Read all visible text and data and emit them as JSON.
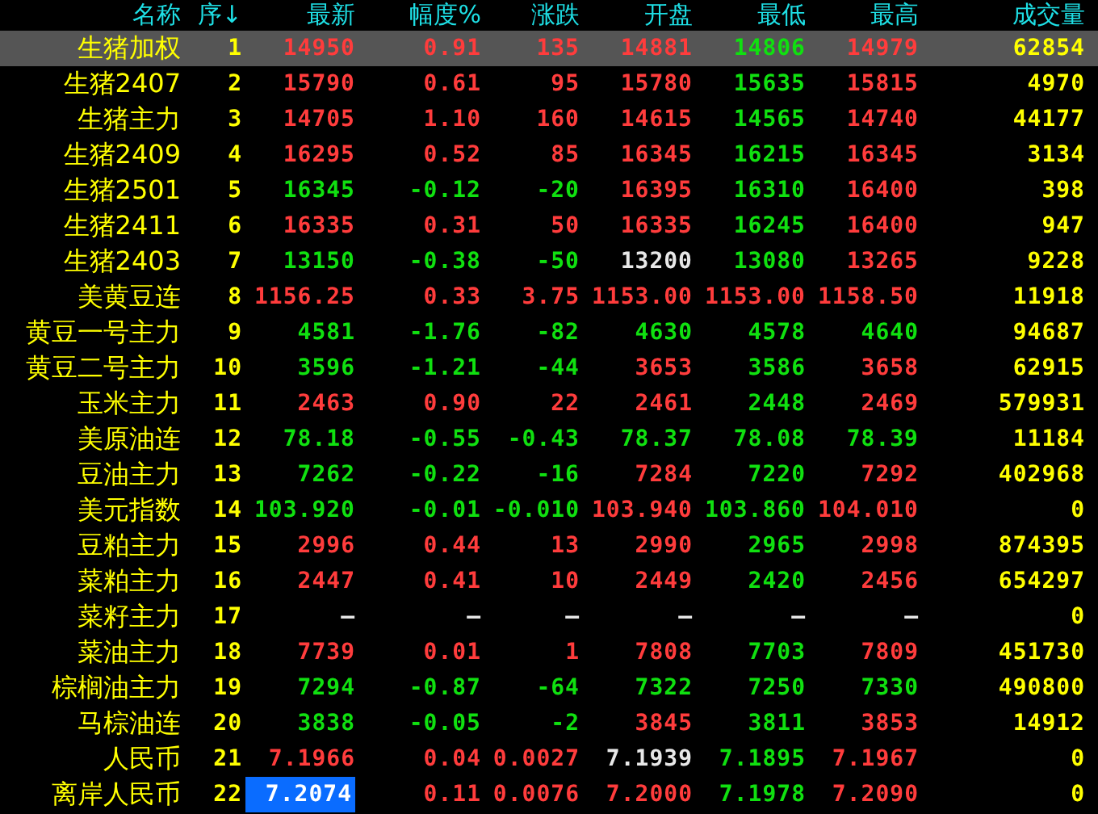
{
  "columns": [
    "名称",
    "序↓",
    "最新",
    "幅度%",
    "涨跌",
    "开盘",
    "最低",
    "最高",
    "成交量"
  ],
  "rows": [
    {
      "name": "生猪加权",
      "index": "1",
      "selected": true,
      "volume": "62854",
      "cells": [
        {
          "text": "14950",
          "color": "#ff3c3c",
          "highlighted": false
        },
        {
          "text": "0.91",
          "color": "#ff3c3c",
          "highlighted": false
        },
        {
          "text": "135",
          "color": "#ff3c3c",
          "highlighted": false
        },
        {
          "text": "14881",
          "color": "#ff3c3c",
          "highlighted": false
        },
        {
          "text": "14806",
          "color": "#10e010",
          "highlighted": false
        },
        {
          "text": "14979",
          "color": "#ff3c3c",
          "highlighted": false
        }
      ]
    },
    {
      "name": "生猪2407",
      "index": "2",
      "selected": false,
      "volume": "4970",
      "cells": [
        {
          "text": "15790",
          "color": "#ff3c3c",
          "highlighted": false
        },
        {
          "text": "0.61",
          "color": "#ff3c3c",
          "highlighted": false
        },
        {
          "text": "95",
          "color": "#ff3c3c",
          "highlighted": false
        },
        {
          "text": "15780",
          "color": "#ff3c3c",
          "highlighted": false
        },
        {
          "text": "15635",
          "color": "#10e010",
          "highlighted": false
        },
        {
          "text": "15815",
          "color": "#ff3c3c",
          "highlighted": false
        }
      ]
    },
    {
      "name": "生猪主力",
      "index": "3",
      "selected": false,
      "volume": "44177",
      "cells": [
        {
          "text": "14705",
          "color": "#ff3c3c",
          "highlighted": false
        },
        {
          "text": "1.10",
          "color": "#ff3c3c",
          "highlighted": false
        },
        {
          "text": "160",
          "color": "#ff3c3c",
          "highlighted": false
        },
        {
          "text": "14615",
          "color": "#ff3c3c",
          "highlighted": false
        },
        {
          "text": "14565",
          "color": "#10e010",
          "highlighted": false
        },
        {
          "text": "14740",
          "color": "#ff3c3c",
          "highlighted": false
        }
      ]
    },
    {
      "name": "生猪2409",
      "index": "4",
      "selected": false,
      "volume": "3134",
      "cells": [
        {
          "text": "16295",
          "color": "#ff3c3c",
          "highlighted": false
        },
        {
          "text": "0.52",
          "color": "#ff3c3c",
          "highlighted": false
        },
        {
          "text": "85",
          "color": "#ff3c3c",
          "highlighted": false
        },
        {
          "text": "16345",
          "color": "#ff3c3c",
          "highlighted": false
        },
        {
          "text": "16215",
          "color": "#10e010",
          "highlighted": false
        },
        {
          "text": "16345",
          "color": "#ff3c3c",
          "highlighted": false
        }
      ]
    },
    {
      "name": "生猪2501",
      "index": "5",
      "selected": false,
      "volume": "398",
      "cells": [
        {
          "text": "16345",
          "color": "#10e010",
          "highlighted": false
        },
        {
          "text": "-0.12",
          "color": "#10e010",
          "highlighted": false
        },
        {
          "text": "-20",
          "color": "#10e010",
          "highlighted": false
        },
        {
          "text": "16395",
          "color": "#ff3c3c",
          "highlighted": false
        },
        {
          "text": "16310",
          "color": "#10e010",
          "highlighted": false
        },
        {
          "text": "16400",
          "color": "#ff3c3c",
          "highlighted": false
        }
      ]
    },
    {
      "name": "生猪2411",
      "index": "6",
      "selected": false,
      "volume": "947",
      "cells": [
        {
          "text": "16335",
          "color": "#ff3c3c",
          "highlighted": false
        },
        {
          "text": "0.31",
          "color": "#ff3c3c",
          "highlighted": false
        },
        {
          "text": "50",
          "color": "#ff3c3c",
          "highlighted": false
        },
        {
          "text": "16335",
          "color": "#ff3c3c",
          "highlighted": false
        },
        {
          "text": "16245",
          "color": "#10e010",
          "highlighted": false
        },
        {
          "text": "16400",
          "color": "#ff3c3c",
          "highlighted": false
        }
      ]
    },
    {
      "name": "生猪2403",
      "index": "7",
      "selected": false,
      "volume": "9228",
      "cells": [
        {
          "text": "13150",
          "color": "#10e010",
          "highlighted": false
        },
        {
          "text": "-0.38",
          "color": "#10e010",
          "highlighted": false
        },
        {
          "text": "-50",
          "color": "#10e010",
          "highlighted": false
        },
        {
          "text": "13200",
          "color": "#e8e8e8",
          "highlighted": false
        },
        {
          "text": "13080",
          "color": "#10e010",
          "highlighted": false
        },
        {
          "text": "13265",
          "color": "#ff3c3c",
          "highlighted": false
        }
      ]
    },
    {
      "name": "美黄豆连",
      "index": "8",
      "selected": false,
      "volume": "11918",
      "cells": [
        {
          "text": "1156.25",
          "color": "#ff3c3c",
          "highlighted": false
        },
        {
          "text": "0.33",
          "color": "#ff3c3c",
          "highlighted": false
        },
        {
          "text": "3.75",
          "color": "#ff3c3c",
          "highlighted": false
        },
        {
          "text": "1153.00",
          "color": "#ff3c3c",
          "highlighted": false
        },
        {
          "text": "1153.00",
          "color": "#ff3c3c",
          "highlighted": false
        },
        {
          "text": "1158.50",
          "color": "#ff3c3c",
          "highlighted": false
        }
      ]
    },
    {
      "name": "黄豆一号主力",
      "index": "9",
      "selected": false,
      "volume": "94687",
      "cells": [
        {
          "text": "4581",
          "color": "#10e010",
          "highlighted": false
        },
        {
          "text": "-1.76",
          "color": "#10e010",
          "highlighted": false
        },
        {
          "text": "-82",
          "color": "#10e010",
          "highlighted": false
        },
        {
          "text": "4630",
          "color": "#10e010",
          "highlighted": false
        },
        {
          "text": "4578",
          "color": "#10e010",
          "highlighted": false
        },
        {
          "text": "4640",
          "color": "#10e010",
          "highlighted": false
        }
      ]
    },
    {
      "name": "黄豆二号主力",
      "index": "10",
      "selected": false,
      "volume": "62915",
      "cells": [
        {
          "text": "3596",
          "color": "#10e010",
          "highlighted": false
        },
        {
          "text": "-1.21",
          "color": "#10e010",
          "highlighted": false
        },
        {
          "text": "-44",
          "color": "#10e010",
          "highlighted": false
        },
        {
          "text": "3653",
          "color": "#ff3c3c",
          "highlighted": false
        },
        {
          "text": "3586",
          "color": "#10e010",
          "highlighted": false
        },
        {
          "text": "3658",
          "color": "#ff3c3c",
          "highlighted": false
        }
      ]
    },
    {
      "name": "玉米主力",
      "index": "11",
      "selected": false,
      "volume": "579931",
      "cells": [
        {
          "text": "2463",
          "color": "#ff3c3c",
          "highlighted": false
        },
        {
          "text": "0.90",
          "color": "#ff3c3c",
          "highlighted": false
        },
        {
          "text": "22",
          "color": "#ff3c3c",
          "highlighted": false
        },
        {
          "text": "2461",
          "color": "#ff3c3c",
          "highlighted": false
        },
        {
          "text": "2448",
          "color": "#10e010",
          "highlighted": false
        },
        {
          "text": "2469",
          "color": "#ff3c3c",
          "highlighted": false
        }
      ]
    },
    {
      "name": "美原油连",
      "index": "12",
      "selected": false,
      "volume": "11184",
      "cells": [
        {
          "text": "78.18",
          "color": "#10e010",
          "highlighted": false
        },
        {
          "text": "-0.55",
          "color": "#10e010",
          "highlighted": false
        },
        {
          "text": "-0.43",
          "color": "#10e010",
          "highlighted": false
        },
        {
          "text": "78.37",
          "color": "#10e010",
          "highlighted": false
        },
        {
          "text": "78.08",
          "color": "#10e010",
          "highlighted": false
        },
        {
          "text": "78.39",
          "color": "#10e010",
          "highlighted": false
        }
      ]
    },
    {
      "name": "豆油主力",
      "index": "13",
      "selected": false,
      "volume": "402968",
      "cells": [
        {
          "text": "7262",
          "color": "#10e010",
          "highlighted": false
        },
        {
          "text": "-0.22",
          "color": "#10e010",
          "highlighted": false
        },
        {
          "text": "-16",
          "color": "#10e010",
          "highlighted": false
        },
        {
          "text": "7284",
          "color": "#ff3c3c",
          "highlighted": false
        },
        {
          "text": "7220",
          "color": "#10e010",
          "highlighted": false
        },
        {
          "text": "7292",
          "color": "#ff3c3c",
          "highlighted": false
        }
      ]
    },
    {
      "name": "美元指数",
      "index": "14",
      "selected": false,
      "volume": "0",
      "cells": [
        {
          "text": "103.920",
          "color": "#10e010",
          "highlighted": false
        },
        {
          "text": "-0.01",
          "color": "#10e010",
          "highlighted": false
        },
        {
          "text": "-0.010",
          "color": "#10e010",
          "highlighted": false
        },
        {
          "text": "103.940",
          "color": "#ff3c3c",
          "highlighted": false
        },
        {
          "text": "103.860",
          "color": "#10e010",
          "highlighted": false
        },
        {
          "text": "104.010",
          "color": "#ff3c3c",
          "highlighted": false
        }
      ]
    },
    {
      "name": "豆粕主力",
      "index": "15",
      "selected": false,
      "volume": "874395",
      "cells": [
        {
          "text": "2996",
          "color": "#ff3c3c",
          "highlighted": false
        },
        {
          "text": "0.44",
          "color": "#ff3c3c",
          "highlighted": false
        },
        {
          "text": "13",
          "color": "#ff3c3c",
          "highlighted": false
        },
        {
          "text": "2990",
          "color": "#ff3c3c",
          "highlighted": false
        },
        {
          "text": "2965",
          "color": "#10e010",
          "highlighted": false
        },
        {
          "text": "2998",
          "color": "#ff3c3c",
          "highlighted": false
        }
      ]
    },
    {
      "name": "菜粕主力",
      "index": "16",
      "selected": false,
      "volume": "654297",
      "cells": [
        {
          "text": "2447",
          "color": "#ff3c3c",
          "highlighted": false
        },
        {
          "text": "0.41",
          "color": "#ff3c3c",
          "highlighted": false
        },
        {
          "text": "10",
          "color": "#ff3c3c",
          "highlighted": false
        },
        {
          "text": "2449",
          "color": "#ff3c3c",
          "highlighted": false
        },
        {
          "text": "2420",
          "color": "#10e010",
          "highlighted": false
        },
        {
          "text": "2456",
          "color": "#ff3c3c",
          "highlighted": false
        }
      ]
    },
    {
      "name": "菜籽主力",
      "index": "17",
      "selected": false,
      "volume": "0",
      "cells": [
        {
          "text": "—",
          "color": "#e8e8e8",
          "highlighted": false
        },
        {
          "text": "—",
          "color": "#e8e8e8",
          "highlighted": false
        },
        {
          "text": "—",
          "color": "#e8e8e8",
          "highlighted": false
        },
        {
          "text": "—",
          "color": "#e8e8e8",
          "highlighted": false
        },
        {
          "text": "—",
          "color": "#e8e8e8",
          "highlighted": false
        },
        {
          "text": "—",
          "color": "#e8e8e8",
          "highlighted": false
        }
      ]
    },
    {
      "name": "菜油主力",
      "index": "18",
      "selected": false,
      "volume": "451730",
      "cells": [
        {
          "text": "7739",
          "color": "#ff3c3c",
          "highlighted": false
        },
        {
          "text": "0.01",
          "color": "#ff3c3c",
          "highlighted": false
        },
        {
          "text": "1",
          "color": "#ff3c3c",
          "highlighted": false
        },
        {
          "text": "7808",
          "color": "#ff3c3c",
          "highlighted": false
        },
        {
          "text": "7703",
          "color": "#10e010",
          "highlighted": false
        },
        {
          "text": "7809",
          "color": "#ff3c3c",
          "highlighted": false
        }
      ]
    },
    {
      "name": "棕榈油主力",
      "index": "19",
      "selected": false,
      "volume": "490800",
      "cells": [
        {
          "text": "7294",
          "color": "#10e010",
          "highlighted": false
        },
        {
          "text": "-0.87",
          "color": "#10e010",
          "highlighted": false
        },
        {
          "text": "-64",
          "color": "#10e010",
          "highlighted": false
        },
        {
          "text": "7322",
          "color": "#10e010",
          "highlighted": false
        },
        {
          "text": "7250",
          "color": "#10e010",
          "highlighted": false
        },
        {
          "text": "7330",
          "color": "#10e010",
          "highlighted": false
        }
      ]
    },
    {
      "name": "马棕油连",
      "index": "20",
      "selected": false,
      "volume": "14912",
      "cells": [
        {
          "text": "3838",
          "color": "#10e010",
          "highlighted": false
        },
        {
          "text": "-0.05",
          "color": "#10e010",
          "highlighted": false
        },
        {
          "text": "-2",
          "color": "#10e010",
          "highlighted": false
        },
        {
          "text": "3845",
          "color": "#ff3c3c",
          "highlighted": false
        },
        {
          "text": "3811",
          "color": "#10e010",
          "highlighted": false
        },
        {
          "text": "3853",
          "color": "#ff3c3c",
          "highlighted": false
        }
      ]
    },
    {
      "name": "人民币",
      "index": "21",
      "selected": false,
      "volume": "0",
      "cells": [
        {
          "text": "7.1966",
          "color": "#ff3c3c",
          "highlighted": false
        },
        {
          "text": "0.04",
          "color": "#ff3c3c",
          "highlighted": false
        },
        {
          "text": "0.0027",
          "color": "#ff3c3c",
          "highlighted": false
        },
        {
          "text": "7.1939",
          "color": "#e8e8e8",
          "highlighted": false
        },
        {
          "text": "7.1895",
          "color": "#10e010",
          "highlighted": false
        },
        {
          "text": "7.1967",
          "color": "#ff3c3c",
          "highlighted": false
        }
      ]
    },
    {
      "name": "离岸人民币",
      "index": "22",
      "selected": false,
      "volume": "0",
      "cells": [
        {
          "text": "7.2074",
          "highlighted": true
        },
        {
          "text": "0.11",
          "color": "#ff3c3c",
          "highlighted": false
        },
        {
          "text": "0.0076",
          "color": "#ff3c3c",
          "highlighted": false
        },
        {
          "text": "7.2000",
          "color": "#ff3c3c",
          "highlighted": false
        },
        {
          "text": "7.1978",
          "color": "#10e010",
          "highlighted": false
        },
        {
          "text": "7.2090",
          "color": "#ff3c3c",
          "highlighted": false
        }
      ]
    }
  ]
}
